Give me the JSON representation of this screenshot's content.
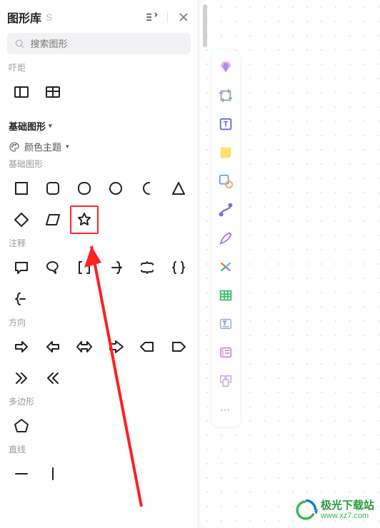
{
  "header": {
    "title": "图形库",
    "subtitle": "S"
  },
  "search": {
    "placeholder": "搜索图形"
  },
  "labels": {
    "truncated_prev": "吓炬",
    "section_basic_title": "基础图形",
    "color_theme": "颜色主题",
    "group_basic": "基础图形",
    "group_annotation": "注释",
    "group_direction": "方向",
    "group_polygon": "多边形",
    "group_line": "直线"
  },
  "shapes": {
    "prev_row": [
      "layout-left-icon",
      "layout-top-icon"
    ],
    "basic": [
      "square-icon",
      "rounded-square-icon",
      "squircle-icon",
      "circle-icon",
      "crescent-icon",
      "triangle-icon",
      "diamond-icon",
      "parallelogram-icon",
      "star-icon"
    ],
    "annotation": [
      "speech-square-icon",
      "speech-round-icon",
      "brackets-icon",
      "brace-open-icon",
      "brace-horizontal-icon",
      "brace-pair-icon",
      "brace-close-icon"
    ],
    "direction": [
      "arrow-right-icon",
      "arrow-left-icon",
      "arrow-leftright-icon",
      "arrow-bold-right-icon",
      "tag-left-icon",
      "tag-right-icon",
      "chevron-double-right-icon",
      "chevron-double-left-icon"
    ],
    "polygon": [
      "pentagon-icon"
    ],
    "line": [
      "line-horizontal-icon",
      "line-vertical-icon"
    ]
  },
  "toolbar": [
    {
      "name": "diamond-tool-icon",
      "colors": [
        "#ff88aa",
        "#8a6bff"
      ]
    },
    {
      "name": "crop-tool-icon",
      "colors": [
        "#8fa3c0"
      ]
    },
    {
      "name": "text-tool-icon",
      "colors": [
        "#5b6bd6"
      ]
    },
    {
      "name": "sticky-note-tool-icon",
      "colors": [
        "#ffd84a"
      ]
    },
    {
      "name": "shape-tool-icon",
      "colors": [
        "#5aa0ff",
        "#ff9f5a"
      ]
    },
    {
      "name": "connector-tool-icon",
      "colors": [
        "#7a6bd6"
      ]
    },
    {
      "name": "pen-tool-icon",
      "colors": [
        "#3ec06c",
        "#b06bff"
      ]
    },
    {
      "name": "mindmap-tool-icon",
      "colors": [
        "#ff6b3e",
        "#49c0ff"
      ]
    },
    {
      "name": "table-tool-icon",
      "colors": [
        "#3ec06c"
      ]
    },
    {
      "name": "textbox-tool-icon",
      "colors": [
        "#5b6bd6"
      ]
    },
    {
      "name": "card-tool-icon",
      "colors": [
        "#d06bc0"
      ]
    },
    {
      "name": "template-tool-icon",
      "colors": [
        "#c06bd6"
      ]
    }
  ],
  "brand": {
    "name": "极光下载站",
    "url": "www.xz7.com"
  }
}
